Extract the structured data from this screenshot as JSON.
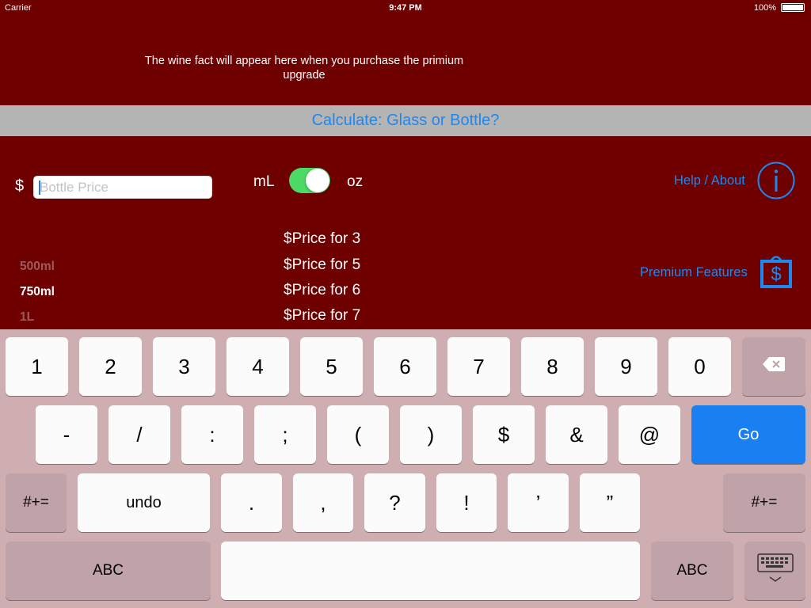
{
  "status_bar": {
    "carrier": "Carrier",
    "time": "9:47 PM",
    "battery": "100%"
  },
  "wine_fact": "The wine fact will appear here when you purchase the primium upgrade",
  "title": "Calculate: Glass or Bottle?",
  "price_input": {
    "currency": "$",
    "placeholder": "Bottle Price",
    "value": ""
  },
  "unit_toggle": {
    "left_label": "mL",
    "right_label": "oz",
    "on": true
  },
  "help_link": "Help / About",
  "premium_link": "Premium Features",
  "size_picker": [
    {
      "label": "500ml",
      "selected": false
    },
    {
      "label": "750ml",
      "selected": true
    },
    {
      "label": "1L",
      "selected": false
    }
  ],
  "price_rows": [
    "$Price for 3",
    "$Price for 5",
    "$Price for 6",
    "$Price for 7"
  ],
  "keyboard": {
    "row1": [
      "1",
      "2",
      "3",
      "4",
      "5",
      "6",
      "7",
      "8",
      "9",
      "0"
    ],
    "row2": [
      "-",
      "/",
      ":",
      ";",
      "(",
      ")",
      "$",
      "&",
      "@"
    ],
    "go": "Go",
    "row3_left": "#+=",
    "undo": "undo",
    "row3": [
      ".",
      ",",
      "?",
      "!",
      "’",
      "”"
    ],
    "row3_right": "#+=",
    "abc_left": "ABC",
    "abc_right": "ABC"
  },
  "icons": {
    "delete": "backspace-icon",
    "info": "info-icon",
    "premium": "shopping-bag-dollar-icon",
    "dismiss": "keyboard-dismiss-icon"
  },
  "colors": {
    "background": "#6e0000",
    "accent": "#1e88f0",
    "toggle_on": "#4cd964",
    "keyboard": "#cfaeb2",
    "go_key": "#1a7ff0"
  }
}
